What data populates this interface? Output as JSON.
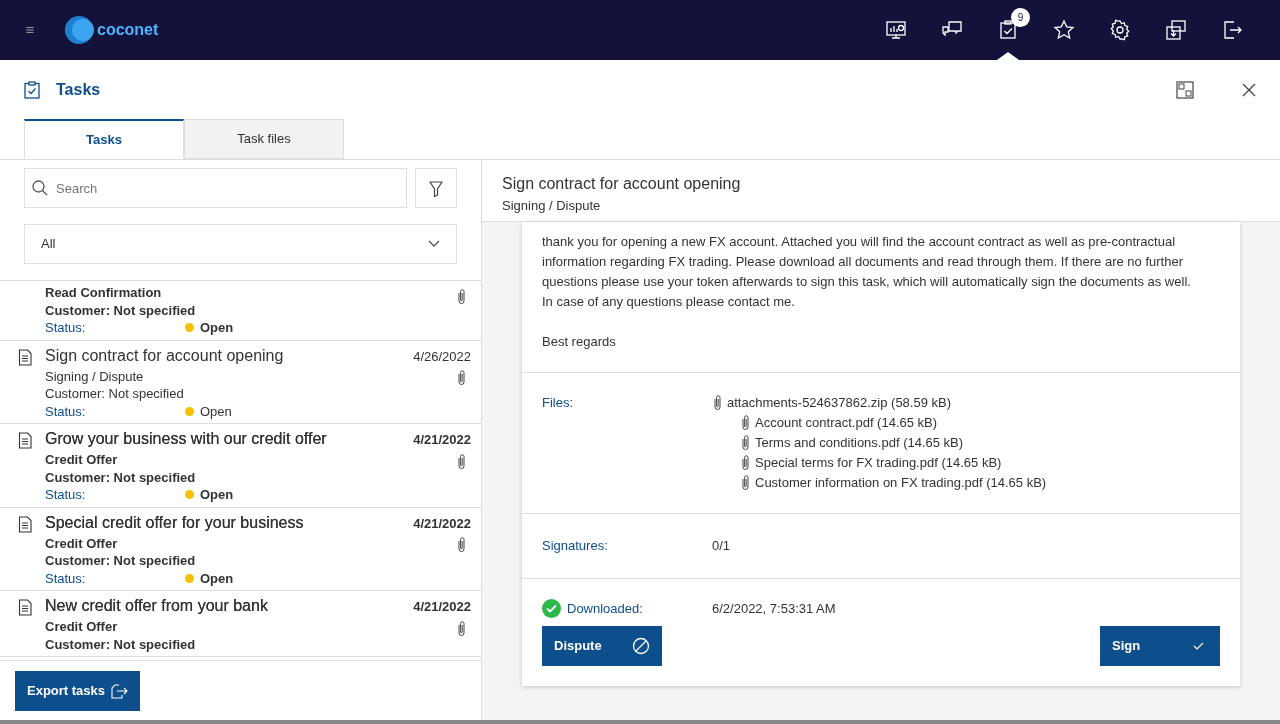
{
  "topbar": {
    "icons": [
      {
        "kind": "monitor",
        "selected": false
      },
      {
        "kind": "chat",
        "selected": false
      },
      {
        "kind": "tasks",
        "selected": true,
        "badge": "9"
      },
      {
        "kind": "star",
        "selected": false
      },
      {
        "kind": "gear",
        "selected": false
      },
      {
        "kind": "transfer",
        "selected": false
      },
      {
        "kind": "logout",
        "selected": false
      }
    ],
    "logo": "coconet"
  },
  "panel": {
    "title": "Tasks"
  },
  "tabs": [
    {
      "label": "Tasks",
      "selected": true
    },
    {
      "label": "Task files",
      "selected": false
    }
  ],
  "search": {
    "placeholder": "Search"
  },
  "filter": {
    "value": "All"
  },
  "tasks": [
    {
      "category": "Read Confirmation",
      "customer": "Customer: Not specified",
      "status_label": "Status:",
      "status": "Open",
      "color": "#f5c000",
      "unread": true,
      "attachment": true
    },
    {
      "title": "Sign contract for account opening",
      "category": "Signing / Dispute",
      "date": "4/26/2022",
      "customer": "Customer: Not specified",
      "status_label": "Status:",
      "status": "Open",
      "color": "#f5c000",
      "unread": false,
      "attachment": true
    },
    {
      "title": "Grow your business with our credit offer",
      "category": "Credit Offer",
      "date": "4/21/2022",
      "customer": "Customer: Not specified",
      "status_label": "Status:",
      "status": "Open",
      "color": "#f5c000",
      "unread": true,
      "attachment": true
    },
    {
      "title": "Special credit offer for your business",
      "category": "Credit Offer",
      "date": "4/21/2022",
      "customer": "Customer: Not specified",
      "status_label": "Status:",
      "status": "Open",
      "color": "#f5c000",
      "unread": true,
      "attachment": true
    },
    {
      "title": "New credit offer from your bank",
      "category": "Credit Offer",
      "date": "4/21/2022",
      "customer": "Customer: Not specified",
      "unread": true,
      "attachment": true
    }
  ],
  "export_button": "Export tasks",
  "detail": {
    "title": "Sign contract for account opening",
    "subtitle": "Signing / Dispute",
    "message": [
      "thank you for opening a new FX account. Attached you will find the account contract as well as pre-contractual information regarding FX trading. Please download all documents and read through them. If there are no further questions please use your token afterwards to sign this task, which will automatically sign the documents as well.",
      "In case of any questions please contact me."
    ],
    "closing": "Best regards",
    "files_label": "Files:",
    "files": [
      {
        "name": "attachments-524637862.zip (58.59 kB)",
        "children": [
          {
            "name": "Account contract.pdf  (14.65 kB)"
          },
          {
            "name": "Terms and conditions.pdf  (14.65 kB)"
          },
          {
            "name": "Special terms for FX trading.pdf  (14.65 kB)"
          },
          {
            "name": "Customer information on FX trading.pdf  (14.65 kB)"
          }
        ]
      }
    ],
    "signatures_label": "Signatures:",
    "signatures": "0/1",
    "downloaded_label": "Downloaded:",
    "downloaded": "6/2/2022, 7:53:31 AM",
    "downloaded_done": true,
    "buttons": [
      {
        "label": "Dispute",
        "kind": "dispute"
      },
      {
        "label": "Sign",
        "kind": "sign"
      }
    ]
  }
}
